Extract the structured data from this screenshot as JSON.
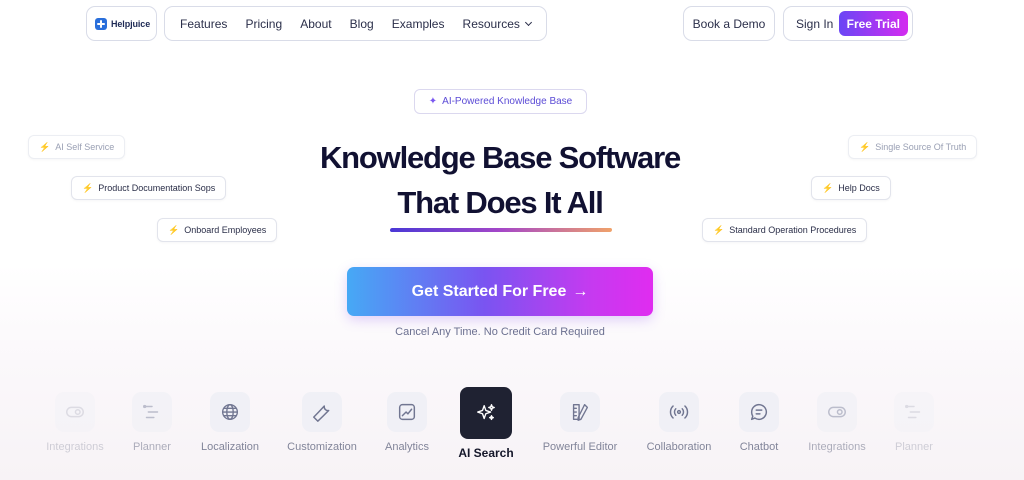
{
  "nav": {
    "logo_text": "Helpjuice",
    "links": [
      "Features",
      "Pricing",
      "About",
      "Blog",
      "Examples",
      "Resources"
    ],
    "book_demo": "Book a Demo",
    "sign_in": "Sign In",
    "free_trial": "Free Trial"
  },
  "hero": {
    "badge": "AI-Powered Knowledge Base",
    "title_line1": "Knowledge Base Software",
    "title_line2": "That Does It All",
    "cta": "Get Started For Free",
    "cta_arrow": "→",
    "subtext": "Cancel Any Time. No Credit Card Required"
  },
  "tags": {
    "left": [
      "AI Self Service",
      "Product Documentation Sops",
      "Onboard Employees"
    ],
    "right": [
      "Single Source Of Truth",
      "Help Docs",
      "Standard Operation Procedures"
    ]
  },
  "features": [
    {
      "label": "Integrations",
      "icon": "toggle-icon"
    },
    {
      "label": "Planner",
      "icon": "planner-icon"
    },
    {
      "label": "Localization",
      "icon": "globe-icon"
    },
    {
      "label": "Customization",
      "icon": "wrench-icon"
    },
    {
      "label": "Analytics",
      "icon": "analytics-icon"
    },
    {
      "label": "AI Search",
      "icon": "sparkles-icon",
      "active": true
    },
    {
      "label": "Powerful Editor",
      "icon": "pencil-ruler-icon"
    },
    {
      "label": "Collaboration",
      "icon": "broadcast-icon"
    },
    {
      "label": "Chatbot",
      "icon": "chat-icon"
    },
    {
      "label": "Integrations",
      "icon": "toggle-icon"
    },
    {
      "label": "Planner",
      "icon": "planner-icon"
    }
  ],
  "colors": {
    "brand_gradient_start": "#6a46f5",
    "brand_gradient_end": "#d42cf0",
    "cta_start": "#46a9f5",
    "cta_end": "#e02cf0",
    "active_feature_bg": "#1f2232",
    "title": "#111132"
  }
}
